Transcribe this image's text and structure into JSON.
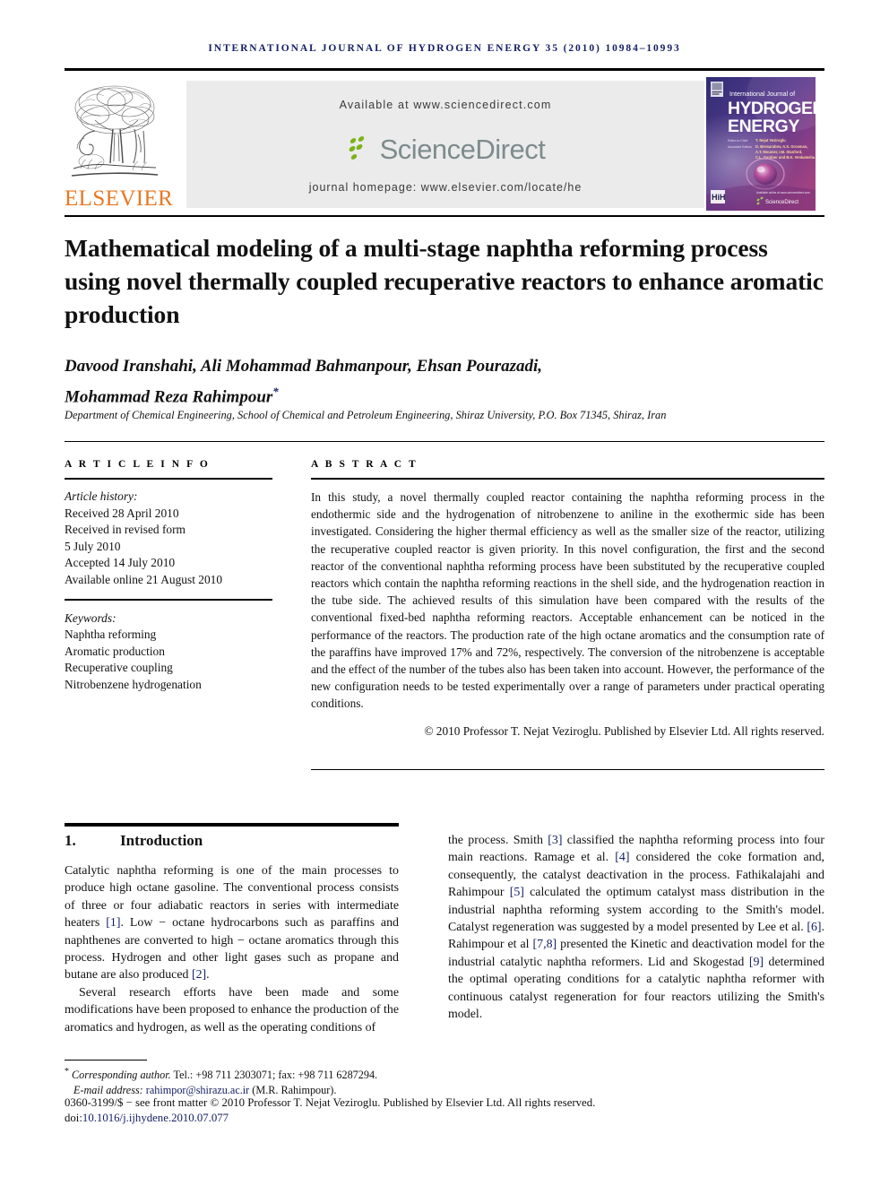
{
  "running_head": "INTERNATIONAL JOURNAL OF HYDROGEN ENERGY 35 (2010) 10984–10993",
  "masthead": {
    "publisher_name": "ELSEVIER",
    "available_at": "Available at www.sciencedirect.com",
    "sciencedirect_label": "ScienceDirect",
    "journal_homepage": "journal homepage: www.elsevier.com/locate/he",
    "cover": {
      "line1": "International Journal of",
      "line2": "HYDROGEN",
      "line3": "ENERGY",
      "editor_label": "Editor-in-Chief",
      "editor_name": "T. Nejat Veziroglu",
      "assoc_label": "Associate Editors",
      "assoc_names_1": "D. Bessarabov, A.S. Grosman, M.A. Grant,",
      "assoc_names_2": "A.T. Mounier, I.M. Stanford,",
      "assoc_names_3": "C.L. Gardner and B.K. Venkatesha",
      "footer_text": "Available online at www.sciencedirect.com",
      "footer_brand": "ScienceDirect"
    }
  },
  "article": {
    "title": "Mathematical modeling of a multi-stage naphtha reforming process using novel thermally coupled recuperative reactors to enhance aromatic production",
    "authors": "Davood Iranshahi, Ali Mohammad Bahmanpour, Ehsan Pourazadi, Mohammad Reza Rahimpour",
    "authors_line1": "Davood Iranshahi, Ali Mohammad Bahmanpour, Ehsan Pourazadi,",
    "authors_line2": "Mohammad Reza Rahimpour",
    "corresponding_marker": "*",
    "affiliation": "Department of Chemical Engineering, School of Chemical and Petroleum Engineering, Shiraz University, P.O. Box 71345, Shiraz, Iran"
  },
  "article_info": {
    "heading": "A R T I C L E   I N F O",
    "history_label": "Article history:",
    "history": [
      "Received 28 April 2010",
      "Received in revised form",
      "5 July 2010",
      "Accepted 14 July 2010",
      "Available online 21 August 2010"
    ],
    "keywords_label": "Keywords:",
    "keywords": [
      "Naphtha reforming",
      "Aromatic production",
      "Recuperative coupling",
      "Nitrobenzene hydrogenation"
    ]
  },
  "abstract": {
    "heading": "A B S T R A C T",
    "text": "In this study, a novel thermally coupled reactor containing the naphtha reforming process in the endothermic side and the hydrogenation of nitrobenzene to aniline in the exothermic side has been investigated. Considering the higher thermal efficiency as well as the smaller size of the reactor, utilizing the recuperative coupled reactor is given priority. In this novel configuration, the first and the second reactor of the conventional naphtha reforming process have been substituted by the recuperative coupled reactors which contain the naphtha reforming reactions in the shell side, and the hydrogenation reaction in the tube side. The achieved results of this simulation have been compared with the results of the conventional fixed-bed naphtha reforming reactors. Acceptable enhancement can be noticed in the performance of the reactors. The production rate of the high octane aromatics and the consumption rate of the paraffins have improved 17% and 72%, respectively. The conversion of the nitrobenzene is acceptable and the effect of the number of the tubes also has been taken into account. However, the performance of the new configuration needs to be tested experimentally over a range of parameters under practical operating conditions.",
    "copyright": "© 2010 Professor T. Nejat Veziroglu. Published by Elsevier Ltd. All rights reserved."
  },
  "body": {
    "section_number": "1.",
    "section_title": "Introduction",
    "left_para_1_a": "Catalytic naphtha reforming is one of the main processes to produce high octane gasoline. The conventional process consists of three or four adiabatic reactors in series with intermediate heaters ",
    "left_para_1_ref1": "[1]",
    "left_para_1_b": ". Low − octane hydrocarbons such as paraffins and naphthenes are converted to high − octane aromatics through this process. Hydrogen and other light gases such as propane and butane are also produced ",
    "left_para_1_ref2": "[2]",
    "left_para_1_c": ".",
    "left_para_2": "Several research efforts have been made and some modifications have been proposed to enhance the production of the aromatics and hydrogen, as well as the operating conditions of",
    "right_a": "the process. Smith ",
    "right_ref3": "[3]",
    "right_b": " classified the naphtha reforming process into four main reactions. Ramage et al. ",
    "right_ref4": "[4]",
    "right_c": " considered the coke formation and, consequently, the catalyst deactivation in the process. Fathikalajahi and Rahimpour ",
    "right_ref5": "[5]",
    "right_d": " calculated the optimum catalyst mass distribution in the industrial naphtha reforming system according to the Smith's model. Catalyst regeneration was suggested by a model presented by Lee et al. ",
    "right_ref6": "[6]",
    "right_e": ". Rahimpour et al ",
    "right_ref78": "[7,8]",
    "right_f": " presented the Kinetic and deactivation model for the industrial catalytic naphtha reformers. Lid and Skogestad ",
    "right_ref9": "[9]",
    "right_g": " determined the optimal operating conditions for a catalytic naphtha reformer with continuous catalyst regeneration for four reactors utilizing the Smith's model."
  },
  "footer": {
    "corresponding_marker": "*",
    "corresponding_label": "Corresponding author.",
    "tel_fax": " Tel.: +98 711 2303071; fax: +98 711 6287294.",
    "email_label": "E-mail address: ",
    "email": "rahimpor@shirazu.ac.ir",
    "email_suffix": " (M.R. Rahimpour).",
    "imprint": "0360-3199/$ − see front matter © 2010 Professor T. Nejat Veziroglu. Published by Elsevier Ltd. All rights reserved.",
    "doi_prefix": "doi:",
    "doi": "10.1016/j.ijhydene.2010.07.077"
  },
  "colors": {
    "elsevier_orange": "#e87722",
    "link_navy": "#141e64",
    "banner_gray": "#ebebeb",
    "sciencedirect_gray": "#7e8b8c",
    "leaf_green": "#7ab317",
    "cover_purple": "#5b3a7e"
  }
}
